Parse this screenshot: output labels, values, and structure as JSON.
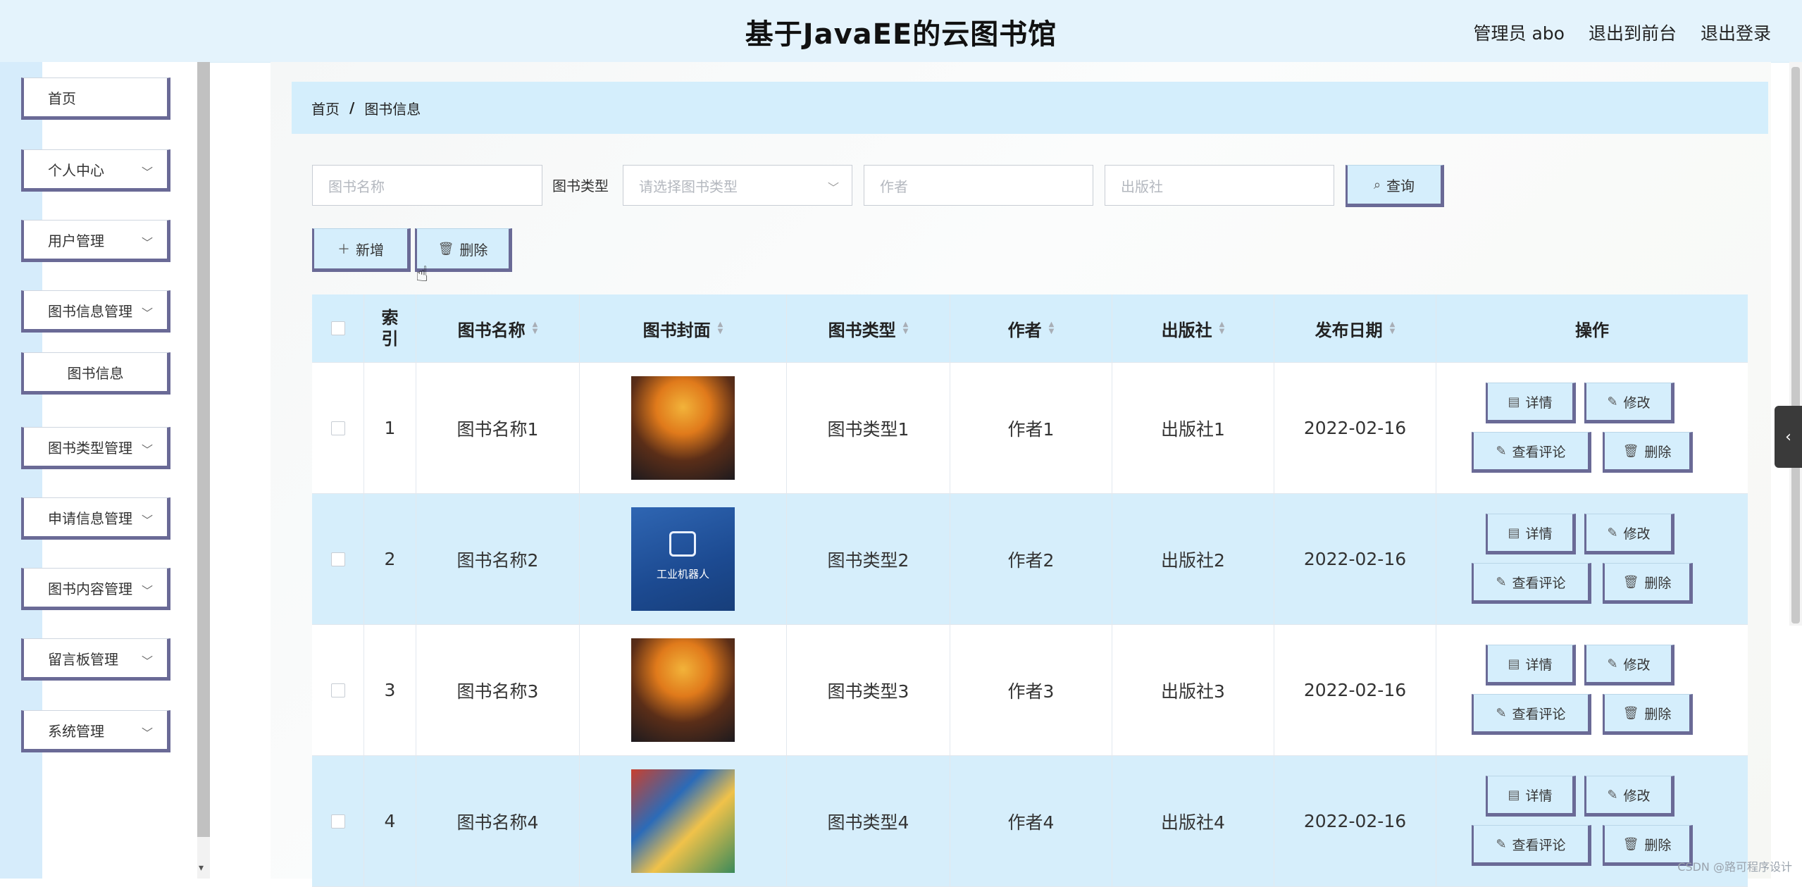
{
  "header": {
    "title": "基于JavaEE的云图书馆",
    "user_label": "管理员 abo",
    "back_label": "退出到前台",
    "logout_label": "退出登录"
  },
  "sidebar": {
    "items": [
      {
        "label": "首页"
      },
      {
        "label": "个人中心"
      },
      {
        "label": "用户管理"
      },
      {
        "label": "图书信息管理"
      },
      {
        "label": "图书信息"
      },
      {
        "label": "图书类型管理"
      },
      {
        "label": "申请信息管理"
      },
      {
        "label": "图书内容管理"
      },
      {
        "label": "留言板管理"
      },
      {
        "label": "系统管理"
      }
    ]
  },
  "breadcrumb": {
    "home": "首页",
    "sep": "/",
    "current": "图书信息"
  },
  "filters": {
    "name_placeholder": "图书名称",
    "type_label": "图书类型",
    "type_placeholder": "请选择图书类型",
    "author_placeholder": "作者",
    "publisher_placeholder": "出版社",
    "search_label": "查询"
  },
  "toolbar": {
    "add_label": "新增",
    "delete_label": "删除"
  },
  "table": {
    "headers": {
      "index_line1": "索",
      "index_line2": "引",
      "name": "图书名称",
      "cover": "图书封面",
      "type": "图书类型",
      "author": "作者",
      "publisher": "出版社",
      "date": "发布日期",
      "ops": "操作"
    },
    "rows": [
      {
        "index": "1",
        "name": "图书名称1",
        "type": "图书类型1",
        "author": "作者1",
        "publisher": "出版社1",
        "date": "2022-02-16"
      },
      {
        "index": "2",
        "name": "图书名称2",
        "type": "图书类型2",
        "author": "作者2",
        "publisher": "出版社2",
        "date": "2022-02-16"
      },
      {
        "index": "3",
        "name": "图书名称3",
        "type": "图书类型3",
        "author": "作者3",
        "publisher": "出版社3",
        "date": "2022-02-16"
      },
      {
        "index": "4",
        "name": "图书名称4",
        "type": "图书类型4",
        "author": "作者4",
        "publisher": "出版社4",
        "date": "2022-02-16"
      }
    ],
    "ops": {
      "detail": "详情",
      "edit": "修改",
      "comments": "查看评论",
      "delete": "删除"
    },
    "cover2_text": "工业机器人"
  },
  "watermark": "CSDN @路可程序设计"
}
